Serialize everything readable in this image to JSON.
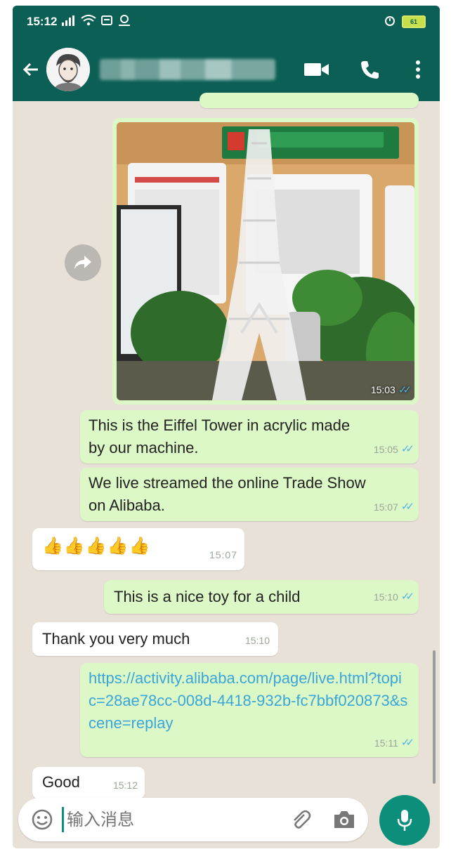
{
  "status_bar": {
    "time": "15:12",
    "signal_icon": "signal-icon",
    "wifi_icon": "wifi-icon",
    "battery_label": "61"
  },
  "header": {
    "contact_name": "",
    "video_icon": "video-call-icon",
    "call_icon": "phone-call-icon",
    "menu_icon": "more-vert-icon"
  },
  "messages": [
    {
      "id": "photo",
      "type": "image",
      "time": "15:03",
      "outgoing": true,
      "read": true
    },
    {
      "id": "m1",
      "text": "This is the Eiffel Tower in acrylic made by our machine.",
      "time": "15:05",
      "outgoing": true,
      "read": true
    },
    {
      "id": "m2",
      "text": "We live streamed the online Trade Show on Alibaba.",
      "time": "15:07",
      "outgoing": true,
      "read": true
    },
    {
      "id": "m3",
      "text": "👍👍👍👍👍",
      "time": "15:07",
      "outgoing": false
    },
    {
      "id": "m4",
      "text": "This is a nice toy for a child",
      "time": "15:10",
      "outgoing": true,
      "read": true
    },
    {
      "id": "m5",
      "text": "Thank you very much",
      "time": "15:10",
      "outgoing": false
    },
    {
      "id": "m6",
      "text": "https://activity.alibaba.com/page/live.html?topic=28ae78cc-008d-4418-932b-fc7bbf020873&scene=replay",
      "time": "15:11",
      "outgoing": true,
      "read": true
    },
    {
      "id": "m7",
      "text": "Good",
      "time": "15:12",
      "outgoing": false
    }
  ],
  "input": {
    "placeholder": "输入消息",
    "emoji_icon": "emoji-icon",
    "attach_icon": "paperclip-icon",
    "camera_icon": "camera-icon",
    "mic_icon": "microphone-icon"
  },
  "colors": {
    "header": "#0b5f55",
    "outgoing_bubble": "#dcf8c6",
    "incoming_bubble": "#ffffff",
    "chat_background": "#e8e1d8",
    "read_ticks": "#4fb3e8",
    "link": "#3aa6d9",
    "fab": "#0b8f7b"
  }
}
